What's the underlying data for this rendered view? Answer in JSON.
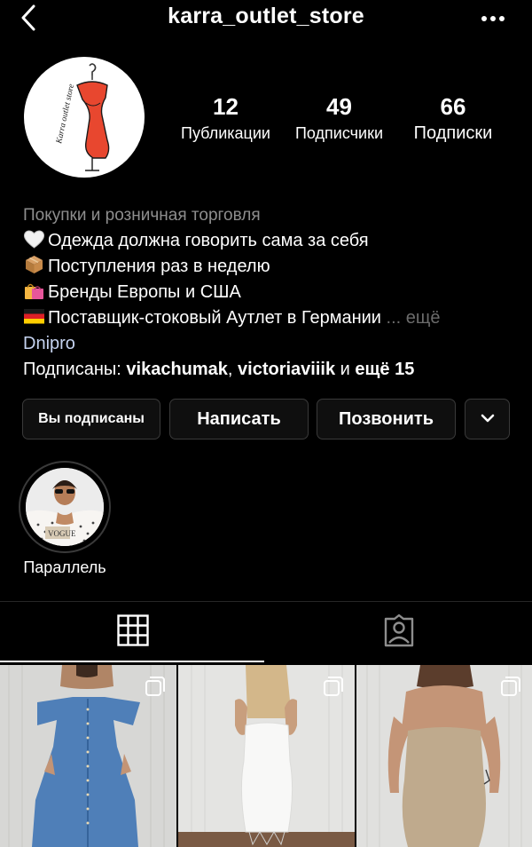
{
  "header": {
    "username": "karra_outlet_store",
    "back_icon": "chevron-left-icon",
    "more_icon": "more-horizontal-icon"
  },
  "avatar": {
    "logo_text": "Karra outlet store"
  },
  "stats": {
    "posts": {
      "count": "12",
      "label": "Публикации"
    },
    "followers": {
      "count": "49",
      "label": "Подписчики"
    },
    "following": {
      "count": "66",
      "label": "Подписки"
    }
  },
  "bio": {
    "category": "Покупки и розничная торговля",
    "lines": [
      {
        "emoji": "white-heart-icon",
        "text": "Одежда должна говорить сама за себя"
      },
      {
        "emoji": "package-icon",
        "text": "Поступления раз в неделю"
      },
      {
        "emoji": "shopping-bags-icon",
        "text": "Бренды Европы и США"
      },
      {
        "emoji": "germany-flag-icon",
        "text": "Поставщик-стоковый Аутлет в Германии"
      }
    ],
    "more": "... ещё",
    "location": "Dnipro",
    "followed_by": {
      "prefix": "Подписаны: ",
      "user1": "vikachumak",
      "sep": ", ",
      "user2": "victoriaviiik",
      "and": " и ",
      "rest": "ещё 15"
    }
  },
  "actions": {
    "following": "Вы подписаны",
    "message": "Написать",
    "call": "Позвонить",
    "dropdown_icon": "chevron-down-icon"
  },
  "highlights": [
    {
      "label": "Параллель",
      "image_text": "VOGUE"
    }
  ],
  "tabs": {
    "grid_icon": "grid-icon",
    "tagged_icon": "tagged-user-icon",
    "active": "grid"
  },
  "posts": [
    {
      "subject": "denim-dress-photo",
      "multi_icon": "carousel-icon"
    },
    {
      "subject": "white-dress-photo",
      "multi_icon": "carousel-icon"
    },
    {
      "subject": "beige-dress-photo",
      "multi_icon": "carousel-icon"
    }
  ],
  "colors": {
    "background": "#000000",
    "button_border": "#3a3a3a",
    "secondary_text": "#8e8e8e",
    "link_text": "#c5d3f0",
    "logo_red": "#e8472f"
  }
}
